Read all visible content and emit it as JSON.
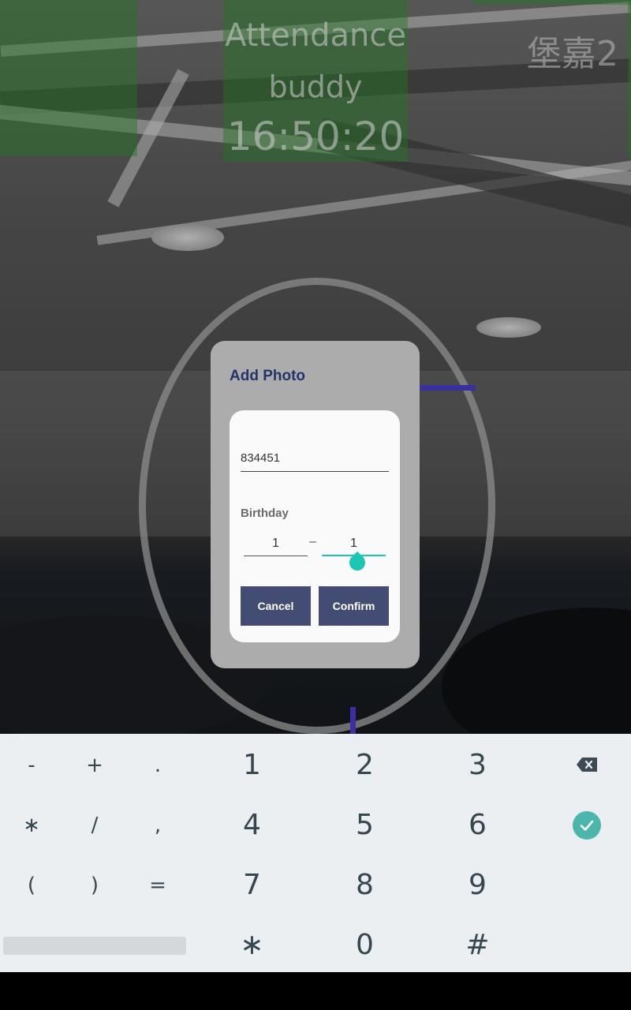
{
  "header": {
    "app_title": "Attendance",
    "app_subtitle": "buddy",
    "clock": "16:50:20",
    "station_label": "堡嘉2"
  },
  "dialog": {
    "title": "Add Photo",
    "id_value": "834451",
    "birthday_label": "Birthday",
    "month_value": "1",
    "date_separator": "–",
    "day_value": "1",
    "cancel_label": "Cancel",
    "confirm_label": "Confirm"
  },
  "keyboard": {
    "symbol_rows": [
      [
        "-",
        "+",
        "."
      ],
      [
        "∗",
        "/",
        ","
      ],
      [
        "(",
        ")",
        "="
      ]
    ],
    "number_rows": [
      [
        "1",
        "2",
        "3"
      ],
      [
        "4",
        "5",
        "6"
      ],
      [
        "7",
        "8",
        "9"
      ],
      [
        "∗",
        "0",
        "#"
      ]
    ],
    "backspace_icon": "backspace-icon",
    "enter_icon": "check-circle-icon"
  },
  "colors": {
    "dialog_title": "#25336b",
    "button_bg": "#434c72",
    "accent_teal": "#1cc6b2",
    "keyboard_bg": "#eceff1",
    "enter_key": "#4db6ac"
  }
}
